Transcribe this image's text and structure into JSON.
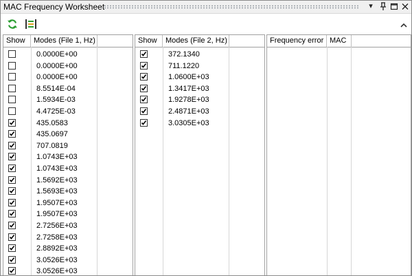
{
  "window": {
    "title": "MAC Frequency Worksheet"
  },
  "titlebar_buttons": {
    "dropdown": "▾",
    "pin": "⊥",
    "restore": "□",
    "close": "✕"
  },
  "toolbar": {
    "refresh_icon": "refresh-icon",
    "pair_icon": "pair-modes-icon",
    "refresh_color": "#2e9e34",
    "pair_color": "#2e9e34"
  },
  "panel1": {
    "headers": {
      "show": "Show",
      "modes": "Modes (File 1, Hz)"
    },
    "rows": [
      {
        "checked": false,
        "value": "0.0000E+00"
      },
      {
        "checked": false,
        "value": "0.0000E+00"
      },
      {
        "checked": false,
        "value": "0.0000E+00"
      },
      {
        "checked": false,
        "value": "8.5514E-04"
      },
      {
        "checked": false,
        "value": "1.5934E-03"
      },
      {
        "checked": false,
        "value": "4.4725E-03"
      },
      {
        "checked": true,
        "value": "435.0583"
      },
      {
        "checked": true,
        "value": "435.0697"
      },
      {
        "checked": true,
        "value": "707.0819"
      },
      {
        "checked": true,
        "value": "1.0743E+03"
      },
      {
        "checked": true,
        "value": "1.0743E+03"
      },
      {
        "checked": true,
        "value": "1.5692E+03"
      },
      {
        "checked": true,
        "value": "1.5693E+03"
      },
      {
        "checked": true,
        "value": "1.9507E+03"
      },
      {
        "checked": true,
        "value": "1.9507E+03"
      },
      {
        "checked": true,
        "value": "2.7256E+03"
      },
      {
        "checked": true,
        "value": "2.7258E+03"
      },
      {
        "checked": true,
        "value": "2.8892E+03"
      },
      {
        "checked": true,
        "value": "3.0526E+03"
      },
      {
        "checked": true,
        "value": "3.0526E+03"
      }
    ]
  },
  "panel2": {
    "headers": {
      "show": "Show",
      "modes": "Modes (File 2, Hz)"
    },
    "rows": [
      {
        "checked": true,
        "value": "372.1340"
      },
      {
        "checked": true,
        "value": "711.1220"
      },
      {
        "checked": true,
        "value": "1.0600E+03"
      },
      {
        "checked": true,
        "value": "1.3417E+03"
      },
      {
        "checked": true,
        "value": "1.9278E+03"
      },
      {
        "checked": true,
        "value": "2.4871E+03"
      },
      {
        "checked": true,
        "value": "3.0305E+03"
      }
    ]
  },
  "panel3": {
    "headers": {
      "freq_error": "Frequency error",
      "mac": "MAC"
    },
    "rows": []
  }
}
